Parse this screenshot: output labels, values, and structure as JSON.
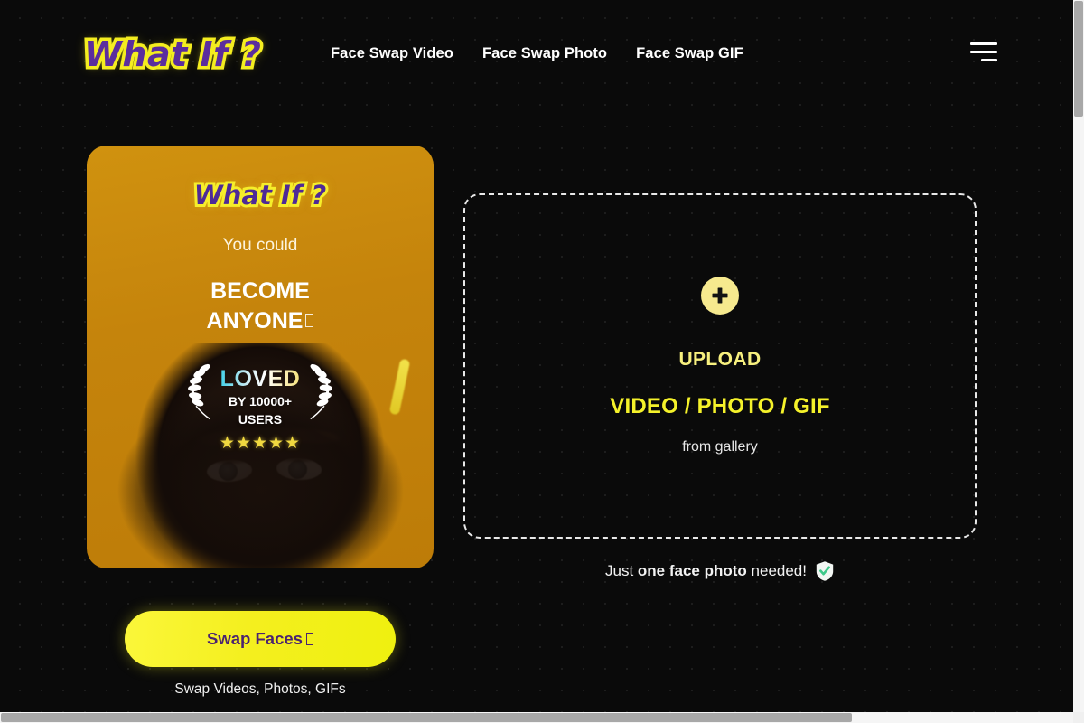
{
  "header": {
    "logo_text": "What If ?",
    "nav": [
      {
        "label": "Face Swap Video"
      },
      {
        "label": "Face Swap Photo"
      },
      {
        "label": "Face Swap GIF"
      }
    ],
    "menu_icon": "hamburger-menu-icon"
  },
  "promo_card": {
    "logo_text": "What If ?",
    "subtitle": "You could",
    "headline_line1": "BECOME",
    "headline_line2": "ANYONE",
    "badge": {
      "loved": "LOVED",
      "by_line1": "BY 10000+",
      "by_line2": "USERS",
      "stars": "★★★★★",
      "star_count": 5,
      "left_icon": "laurel-wreath-left-icon",
      "right_icon": "laurel-wreath-right-icon"
    }
  },
  "cta": {
    "button_label": "Swap Faces",
    "caption": "Swap Videos, Photos, GIFs"
  },
  "dropzone": {
    "plus_icon": "plus-icon",
    "upload_label": "UPLOAD",
    "types_label": "VIDEO / PHOTO / GIF",
    "from_label": "from gallery"
  },
  "note": {
    "prefix": "Just ",
    "emphasis": "one face photo",
    "suffix": " needed!",
    "icon": "shield-check-icon"
  },
  "colors": {
    "page_background": "#0a0a0a",
    "brand_yellow": "#f5f22a",
    "brand_purple": "#4e2a96",
    "card_orange": "#c5840c",
    "pale_yellow": "#f6e98e",
    "shield_green": "#3ec98a"
  }
}
